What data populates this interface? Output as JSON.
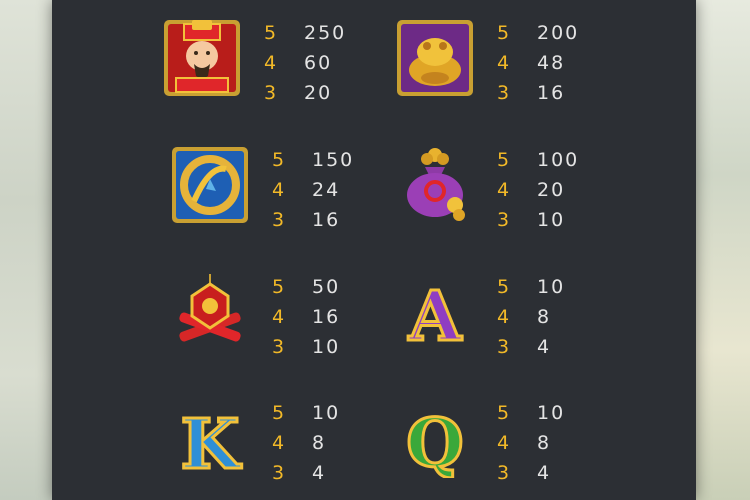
{
  "colors": {
    "panel_bg": "#2c2f34",
    "count_color": "#f2b928",
    "amount_color": "#e4e4e4"
  },
  "paytable": [
    {
      "symbol_name": "fortune-god-icon",
      "pays": [
        {
          "count": "5",
          "amount": "250"
        },
        {
          "count": "4",
          "amount": "60"
        },
        {
          "count": "3",
          "amount": "20"
        }
      ]
    },
    {
      "symbol_name": "golden-toad-icon",
      "pays": [
        {
          "count": "5",
          "amount": "200"
        },
        {
          "count": "4",
          "amount": "48"
        },
        {
          "count": "3",
          "amount": "16"
        }
      ]
    },
    {
      "symbol_name": "golden-dragon-icon",
      "pays": [
        {
          "count": "5",
          "amount": "150"
        },
        {
          "count": "4",
          "amount": "24"
        },
        {
          "count": "3",
          "amount": "16"
        }
      ]
    },
    {
      "symbol_name": "money-bag-icon",
      "pays": [
        {
          "count": "5",
          "amount": "100"
        },
        {
          "count": "4",
          "amount": "20"
        },
        {
          "count": "3",
          "amount": "10"
        }
      ]
    },
    {
      "symbol_name": "firecracker-icon",
      "pays": [
        {
          "count": "5",
          "amount": "50"
        },
        {
          "count": "4",
          "amount": "16"
        },
        {
          "count": "3",
          "amount": "10"
        }
      ]
    },
    {
      "symbol_name": "letter-a-icon",
      "letter": "A",
      "pays": [
        {
          "count": "5",
          "amount": "10"
        },
        {
          "count": "4",
          "amount": "8"
        },
        {
          "count": "3",
          "amount": "4"
        }
      ]
    },
    {
      "symbol_name": "letter-k-icon",
      "letter": "K",
      "pays": [
        {
          "count": "5",
          "amount": "10"
        },
        {
          "count": "4",
          "amount": "8"
        },
        {
          "count": "3",
          "amount": "4"
        }
      ]
    },
    {
      "symbol_name": "letter-q-icon",
      "letter": "Q",
      "pays": [
        {
          "count": "5",
          "amount": "10"
        },
        {
          "count": "4",
          "amount": "8"
        },
        {
          "count": "3",
          "amount": "4"
        }
      ]
    }
  ]
}
